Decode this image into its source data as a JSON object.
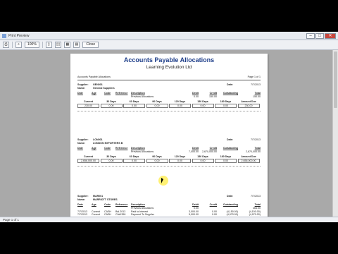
{
  "window": {
    "title": "Print Preview",
    "close_label": "Close",
    "zoom": "100%"
  },
  "status": {
    "page": "Page 1 of 1"
  },
  "report": {
    "title": "Accounts Payable Allocations",
    "subtitle": "Learning Evolution Ltd",
    "header_left": "Accounts Payable Allocations",
    "header_right": "Page 1 of 1",
    "suppliers": [
      {
        "code": "GEN001",
        "name": "General Suppliers",
        "date": "7/7/2013",
        "rows": [
          {
            "date": "",
            "age": "",
            "code": "",
            "ref": "",
            "desc": "Previous Allocations",
            "debit": "0.00",
            "credit": "150.00",
            "outstanding": "",
            "total": "150.00"
          }
        ],
        "aging": {
          "current": "230.00",
          "d30": "0.00",
          "d60": "0.00",
          "d90": "0.00",
          "d120": "0.00",
          "d150": "0.00",
          "d180": "0.00",
          "due": "230.00"
        }
      },
      {
        "code": "LON001",
        "name": "LONDON EXPORTERS B",
        "date": "7/7/2013",
        "rows": [
          {
            "date": "",
            "age": "",
            "code": "",
            "ref": "",
            "desc": "Previous Allocations",
            "debit": "7,000.00",
            "credit": "2,670,000.00",
            "outstanding": "",
            "total": "2,670,000.00"
          }
        ],
        "aging": {
          "current": "2,656,000.00",
          "d30": "0.00",
          "d60": "0.00",
          "d90": "0.00",
          "d120": "0.00",
          "d150": "0.00",
          "d180": "0.00",
          "due": "2,656,000.00"
        }
      },
      {
        "code": "MAR001",
        "name": "MARRIOTT STORES",
        "date": "7/7/2013",
        "rows": [
          {
            "date": "",
            "age": "",
            "code": "",
            "ref": "",
            "desc": "Previous Allocations",
            "debit": "0.00",
            "credit": "",
            "outstanding": "",
            "total": "464.00"
          },
          {
            "date": "7/7/2013",
            "age": "Current",
            "code": "CASH",
            "ref": "Bal.2013",
            "desc": "Paid to Interest",
            "debit": "3,000.00",
            "credit": "0.00",
            "outstanding": "(4,150.00)",
            "total": "(4,150.00)"
          },
          {
            "date": "7/7/2013",
            "age": "Current",
            "code": "CASH",
            "ref": "Chk1350",
            "desc": "Payment To Supplier",
            "debit": "5,000.00",
            "credit": "0.00",
            "outstanding": "(4,970.00)",
            "total": "(4,970.00)"
          }
        ],
        "aging": {
          "current": "(8,120.00)",
          "d30": "0.00",
          "d60": "0.00",
          "d90": "0.00",
          "d120": "0.00",
          "d150": "0.00",
          "d180": "0.00",
          "due": "(8,120.00)"
        }
      }
    ],
    "labels": {
      "supplier": "Supplier:",
      "name": "Name:",
      "date": "Date:",
      "col_date": "Date",
      "col_age": "Age",
      "col_code": "Code",
      "col_ref": "Reference",
      "col_desc": "Description",
      "col_debit": "Debit",
      "col_credit": "Credit",
      "col_out": "Outstanding",
      "col_total": "Total",
      "a_current": "Current",
      "a_30": "30 Days",
      "a_60": "60 Days",
      "a_90": "90 Days",
      "a_120": "120 Days",
      "a_150": "150 Days",
      "a_180": "180 Days",
      "a_due": "Amount Due"
    }
  }
}
